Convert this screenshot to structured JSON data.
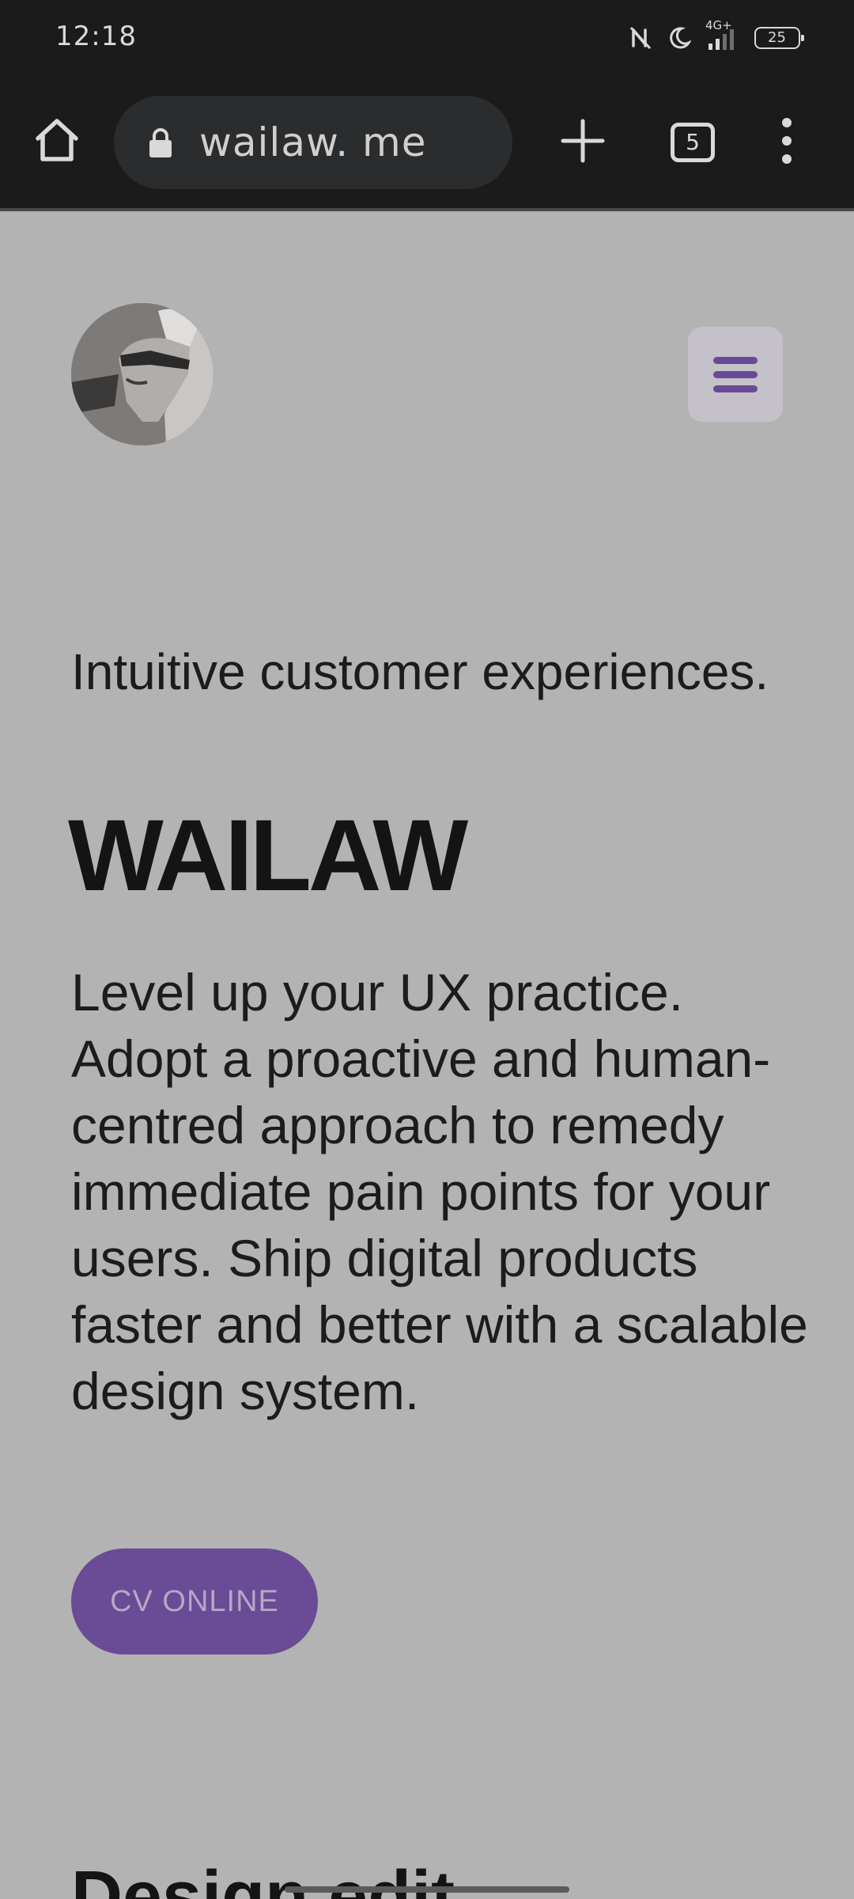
{
  "status_bar": {
    "time": "12:18",
    "network": "4G+",
    "battery": "25",
    "icons": [
      "nfc-off-icon",
      "do-not-disturb-moon-icon",
      "signal-icon",
      "battery-icon"
    ]
  },
  "browser": {
    "url": "wailaw. me",
    "tab_count": "5",
    "icons": [
      "home-icon",
      "lock-icon",
      "plus-icon",
      "tabs-icon",
      "more-vert-icon"
    ]
  },
  "page": {
    "tagline": "Intuitive customer experiences.",
    "brand": "WAILAW",
    "description": "Level up your UX practice. Adopt a proactive and human-centred approach to remedy immediate pain points for your users. Ship digital products faster and better with a scalable design system.",
    "cta_label": "CV ONLINE",
    "next_section_heading_partial": "Design edit"
  },
  "colors": {
    "browser_chrome": "#1b1b1c",
    "page_background": "#b3b3b3",
    "accent": "#6a4b95",
    "text": "#1c1c1c"
  }
}
